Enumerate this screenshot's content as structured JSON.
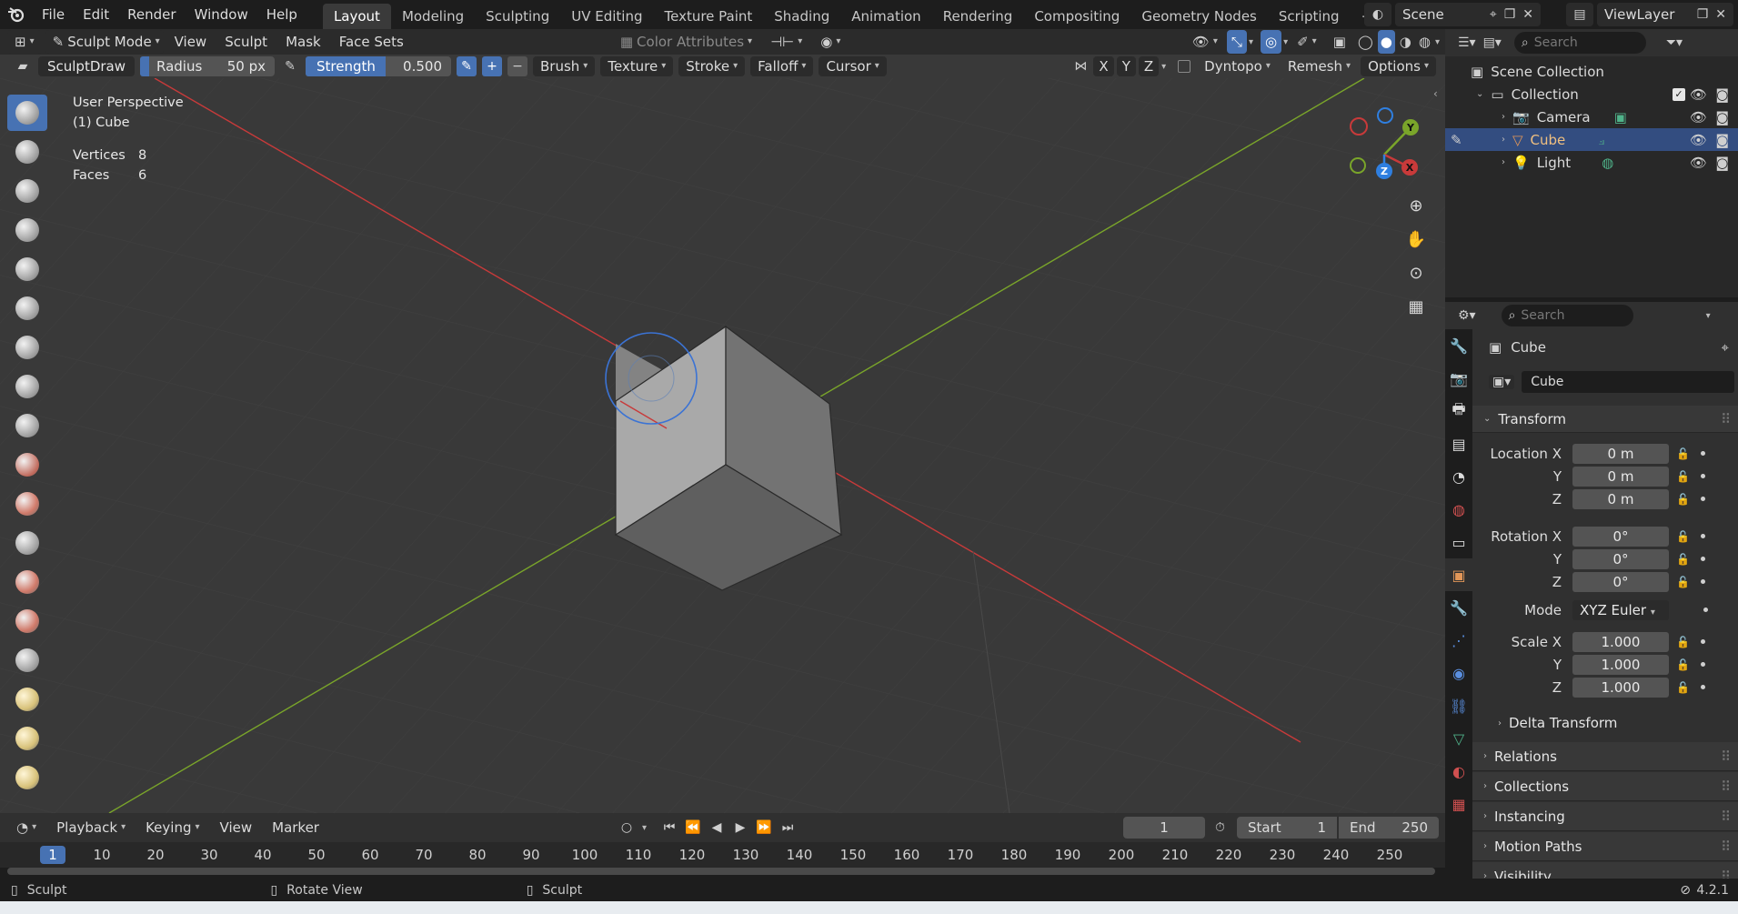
{
  "menubar": {
    "menus": [
      "File",
      "Edit",
      "Render",
      "Window",
      "Help"
    ],
    "workspaces": [
      "Layout",
      "Modeling",
      "Sculpting",
      "UV Editing",
      "Texture Paint",
      "Shading",
      "Animation",
      "Rendering",
      "Compositing",
      "Geometry Nodes",
      "Scripting"
    ],
    "active_workspace": "Layout",
    "add_tab": "+",
    "scene": "Scene",
    "view_layer": "ViewLayer"
  },
  "header": {
    "mode": "Sculpt Mode",
    "menus": [
      "View",
      "Sculpt",
      "Mask",
      "Face Sets"
    ],
    "color_attributes": "Color Attributes"
  },
  "tool_settings": {
    "brush_name": "SculptDraw",
    "radius_label": "Radius",
    "radius_value": "50 px",
    "strength_label": "Strength",
    "strength_value": "0.500",
    "plus": "+",
    "minus": "−",
    "dropdowns": [
      "Brush",
      "Texture",
      "Stroke",
      "Falloff",
      "Cursor"
    ],
    "axes": [
      "X",
      "Y",
      "Z"
    ],
    "dyntopo": "Dyntopo",
    "remesh": "Remesh",
    "options": "Options"
  },
  "viewport": {
    "perspective": "User Perspective",
    "object": "(1) Cube",
    "vertices_label": "Vertices",
    "vertices": "8",
    "faces_label": "Faces",
    "faces": "6",
    "gizmo_axes": [
      "X",
      "Y",
      "Z"
    ]
  },
  "outliner": {
    "search_placeholder": "Search",
    "root": "Scene Collection",
    "collection": "Collection",
    "items": [
      {
        "name": "Camera",
        "color": "#e19658"
      },
      {
        "name": "Cube",
        "color": "#e19658"
      },
      {
        "name": "Light",
        "color": "#e19658"
      }
    ],
    "selected": "Cube"
  },
  "properties": {
    "search_placeholder": "Search",
    "object_name": "Cube",
    "data_name": "Cube",
    "transform_title": "Transform",
    "location_label": "Location X",
    "location": [
      "0 m",
      "0 m",
      "0 m"
    ],
    "rotation_label": "Rotation X",
    "rotation": [
      "0°",
      "0°",
      "0°"
    ],
    "mode_label": "Mode",
    "mode_value": "XYZ Euler",
    "scale_label": "Scale X",
    "scale": [
      "1.000",
      "1.000",
      "1.000"
    ],
    "axis_y": "Y",
    "axis_z": "Z",
    "delta_transform": "Delta Transform",
    "collapsed_sections": [
      "Relations",
      "Collections",
      "Instancing",
      "Motion Paths",
      "Visibility"
    ]
  },
  "timeline": {
    "menus": [
      "Playback",
      "Keying",
      "View",
      "Marker"
    ],
    "current_frame": "1",
    "start_label": "Start",
    "start": "1",
    "end_label": "End",
    "end": "250",
    "ticks": [
      "10",
      "20",
      "30",
      "40",
      "50",
      "60",
      "70",
      "80",
      "90",
      "100",
      "110",
      "120",
      "130",
      "140",
      "150",
      "160",
      "170",
      "180",
      "190",
      "200",
      "210",
      "220",
      "230",
      "240",
      "250"
    ],
    "frame_marker": "1"
  },
  "statusbar": {
    "left": "Sculpt",
    "middle": "Rotate View",
    "right_action": "Sculpt",
    "version": "4.2.1"
  },
  "colors": {
    "accent": "#4772b3",
    "x_axis": "#c83a3a",
    "y_axis": "#7aa52a",
    "z_axis": "#2f7fe0"
  }
}
